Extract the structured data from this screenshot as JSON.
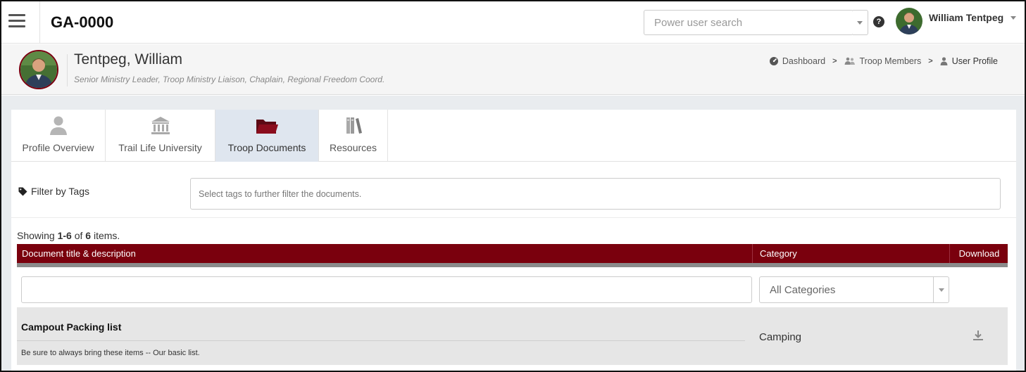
{
  "topbar": {
    "app_title": "GA-0000",
    "search_placeholder": "Power user search",
    "help_label": "?",
    "user_name": "William Tentpeg"
  },
  "profile": {
    "name": "Tentpeg, William",
    "roles": "Senior Ministry Leader, Troop Ministry Liaison, Chaplain, Regional Freedom Coord."
  },
  "breadcrumb": [
    {
      "label": "Dashboard",
      "icon": "dashboard-icon"
    },
    {
      "label": "Troop Members",
      "icon": "users-icon"
    },
    {
      "label": "User Profile",
      "icon": "user-icon"
    }
  ],
  "tabs": [
    {
      "label": "Profile Overview",
      "icon": "person-icon",
      "active": false
    },
    {
      "label": "Trail Life University",
      "icon": "university-icon",
      "active": false
    },
    {
      "label": "Troop Documents",
      "icon": "folder-icon",
      "active": true
    },
    {
      "label": "Resources",
      "icon": "books-icon",
      "active": false
    }
  ],
  "filter": {
    "label": "Filter by Tags",
    "placeholder": "Select tags to further filter the documents."
  },
  "summary": {
    "prefix": "Showing ",
    "range": "1-6",
    "mid": " of ",
    "total": "6",
    "suffix": " items."
  },
  "table": {
    "headers": {
      "title": "Document title & description",
      "category": "Category",
      "download": "Download"
    },
    "category_filter": "All Categories",
    "rows": [
      {
        "title": "Campout Packing list",
        "description": "Be sure to always bring these items -- Our basic list.",
        "category": "Camping"
      }
    ]
  },
  "colors": {
    "brand": "#7a000d",
    "active_tab": "#dfe6ef",
    "row_bg": "#e6e6e6"
  }
}
